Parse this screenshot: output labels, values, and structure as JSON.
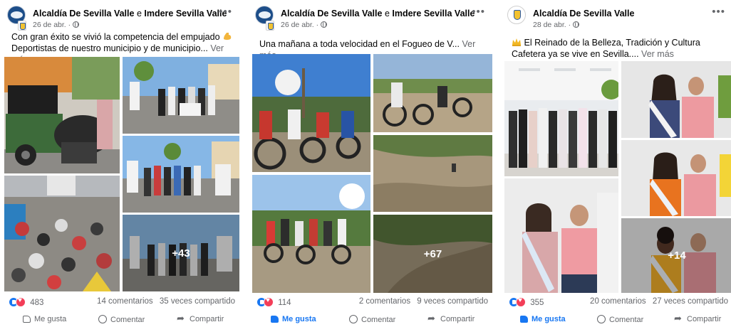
{
  "posts": [
    {
      "page_name": "Alcaldía De Sevilla Valle",
      "page_name_joiner": "e",
      "page_name_second": "Imdere Sevilla Valle",
      "date": "26 de abr. ·",
      "avatar": "alcaldia-logo",
      "text_line1": "Con gran éxito se vivió la competencia del empujado",
      "text_line2": "Deportistas de nuestro municipio y de municipio...",
      "emoji": "flexed-biceps-emoji",
      "see_more": "Ver más",
      "more_photos": "+43",
      "reaction_count": "483",
      "comments": "14 comentarios",
      "shares": "35 veces compartido",
      "liked": false
    },
    {
      "page_name": "Alcaldía De Sevilla Valle",
      "page_name_joiner": "e",
      "page_name_second": "Imdere Sevilla Valle",
      "date": "26 de abr. ·",
      "avatar": "alcaldia-logo",
      "text_line1": "Una mañana a toda velocidad en el Fogueo de V...",
      "see_more": "Ver más",
      "more_photos": "+67",
      "reaction_count": "114",
      "comments": "2 comentarios",
      "shares": "9 veces compartido",
      "liked": true
    },
    {
      "page_name": "Alcaldía De Sevilla Valle",
      "date": "28 de abr. ·",
      "avatar": "municipal-crest",
      "text_line1": "El Reinado de la Belleza, Tradición y Cultura",
      "text_line2": "Cafetera ya se vive en Sevilla....",
      "emoji": "crown-sparkles-emoji",
      "see_more": "Ver más",
      "more_photos": "+14",
      "reaction_count": "355",
      "comments": "20 comentarios",
      "shares": "27 veces compartido",
      "liked": true
    }
  ],
  "actions": {
    "like": "Me gusta",
    "comment": "Comentar",
    "share": "Compartir"
  },
  "icons": {
    "more": "more-options-icon",
    "privacy": "globe-icon",
    "like": "like-icon",
    "love": "love-icon",
    "comment": "comment-icon",
    "share": "share-icon"
  },
  "colors": {
    "facebook_blue": "#1877f2",
    "love_red": "#f33e58",
    "secondary_text": "#65676b",
    "primary_text": "#050505"
  }
}
